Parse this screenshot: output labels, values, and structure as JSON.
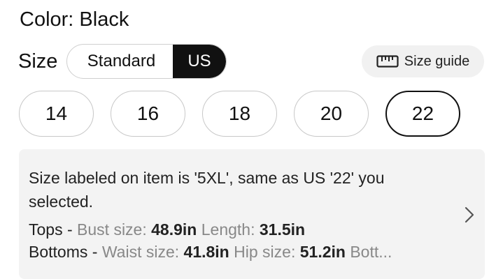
{
  "color": {
    "label": "Color: Black"
  },
  "size_selector": {
    "label": "Size",
    "tabs": [
      {
        "label": "Standard",
        "active": false
      },
      {
        "label": "US",
        "active": true
      }
    ],
    "guide_label": "Size guide",
    "guide_icon": "ruler-icon"
  },
  "sizes": [
    {
      "label": "14",
      "selected": false
    },
    {
      "label": "16",
      "selected": false
    },
    {
      "label": "18",
      "selected": false
    },
    {
      "label": "20",
      "selected": false
    },
    {
      "label": "22",
      "selected": true
    }
  ],
  "info": {
    "message": "Size labeled on item is '5XL', same as US '22' you selected.",
    "tops": {
      "prefix": "Tops - ",
      "bust_label": "Bust size: ",
      "bust_value": "48.9in",
      "length_label": "Length: ",
      "length_value": "31.5in"
    },
    "bottoms": {
      "prefix": "Bottoms - ",
      "waist_label": "Waist size: ",
      "waist_value": "41.8in",
      "hip_label": "Hip size: ",
      "hip_value": "51.2in",
      "more_label": "Bott..."
    },
    "chevron_icon": "chevron-right-icon"
  },
  "colors": {
    "text": "#111111",
    "muted_label": "#888888",
    "panel_bg": "#f3f3f3",
    "active_tab_bg": "#111111"
  }
}
